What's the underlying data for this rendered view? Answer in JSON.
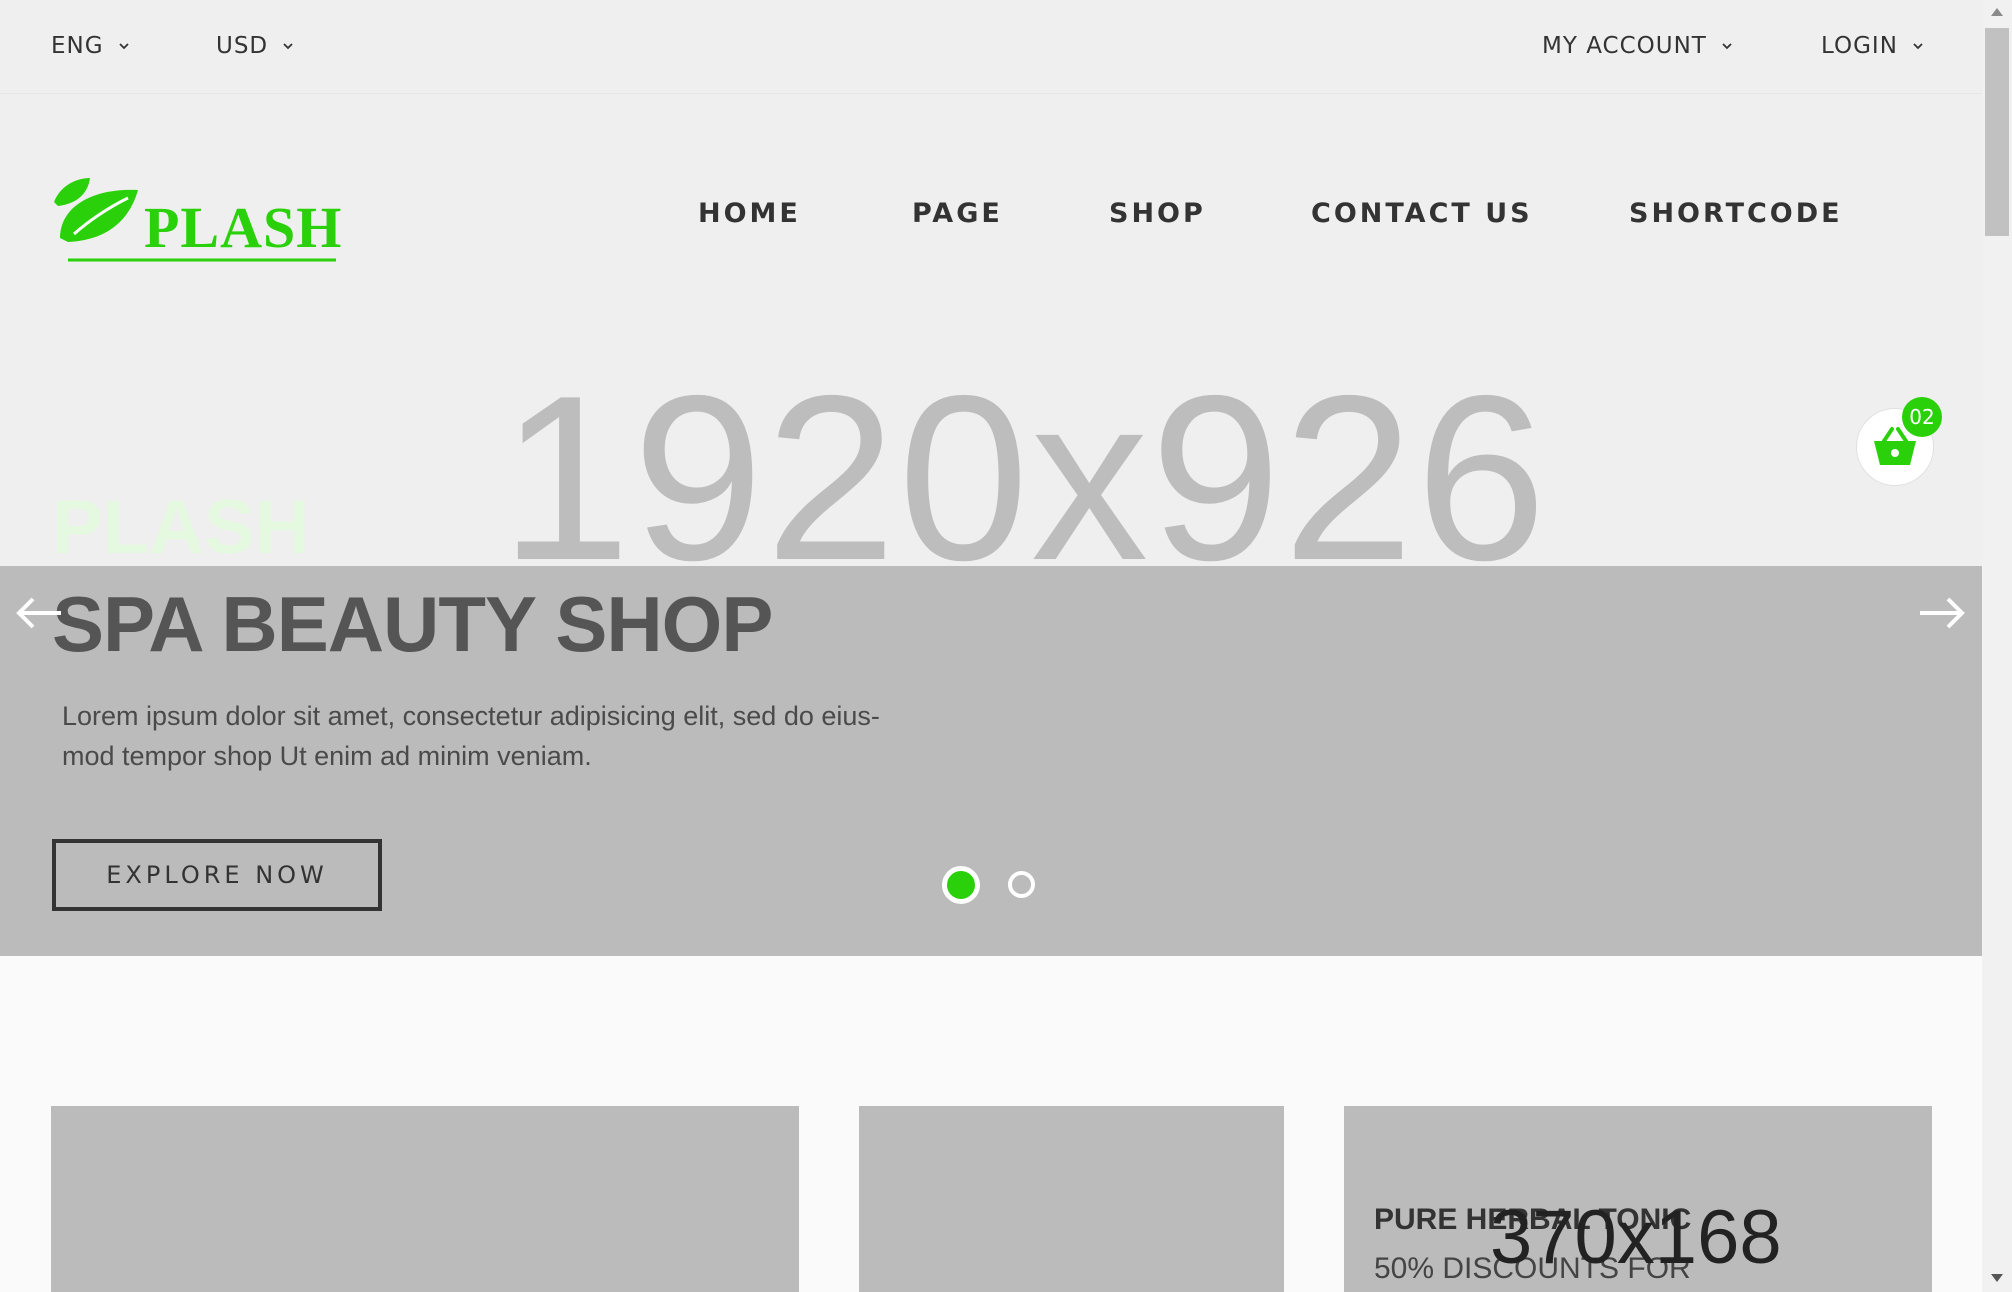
{
  "topbar": {
    "language": "ENG",
    "currency": "USD",
    "account": "MY ACCOUNT",
    "login": "LOGIN"
  },
  "logo": {
    "text": "PLASH",
    "color": "#2ad10a"
  },
  "nav": {
    "items": [
      {
        "label": "HOME"
      },
      {
        "label": "PAGE"
      },
      {
        "label": "SHOP"
      },
      {
        "label": "CONTACT US"
      },
      {
        "label": "SHORTCODE"
      }
    ]
  },
  "cart": {
    "count": "02",
    "icon": "basket-icon"
  },
  "hero": {
    "placeholder": "1920x926",
    "kicker": "PLASH",
    "title": "SPA BEAUTY SHOP",
    "text_line1": "Lorem ipsum dolor sit amet, consectetur adipisicing elit, sed do eius-",
    "text_line2": "mod tempor shop Ut enim ad minim veniam.",
    "button": "EXPLORE NOW",
    "slides": 2,
    "active_slide": 1,
    "prev_icon": "arrow-left-icon",
    "next_icon": "arrow-right-icon"
  },
  "banners": {
    "placeholder": "370x168",
    "title": "PURE HERBAL TONIC",
    "subtitle": "50% DISCOUNTS FOR"
  },
  "colors": {
    "accent": "#2ad10a",
    "placeholder_bg": "#bbbbbb",
    "header_bg": "#efefef"
  }
}
